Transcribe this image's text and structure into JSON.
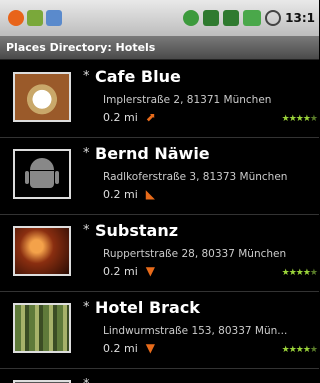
{
  "status_bar": {
    "time": "13:1",
    "icons_left": [
      "notification-icon",
      "android-icon",
      "download-icon"
    ],
    "icons_right": [
      "phone-icon",
      "network-icon",
      "signal-icon",
      "battery-icon",
      "alarm-icon"
    ]
  },
  "title": "Places Directory: Hotels",
  "places": [
    {
      "name": "Cafe Blue",
      "address": "Implerstraße 2, 81371 München",
      "distance": "0.2 mi",
      "direction_icon": "northeast-arrow-icon",
      "direction_glyph": "⬈",
      "rating": 4,
      "rating_max": 5,
      "thumb": "cafe-photo"
    },
    {
      "name": "Bernd Näwie",
      "address": "Radlkoferstraße 3, 81373 München",
      "distance": "0.2 mi",
      "direction_icon": "north-arrow-icon",
      "direction_glyph": "◣",
      "rating": 0,
      "rating_max": 5,
      "thumb": "android-placeholder"
    },
    {
      "name": "Substanz",
      "address": "Ruppertstraße 28, 80337 München",
      "distance": "0.2 mi",
      "direction_icon": "south-arrow-icon",
      "direction_glyph": "▼",
      "rating": 4,
      "rating_max": 5,
      "thumb": "club-photo"
    },
    {
      "name": "Hotel Brack",
      "address": "Lindwurmstraße 153, 80337 Mün...",
      "distance": "0.2 mi",
      "direction_icon": "south-arrow-icon",
      "direction_glyph": "▼",
      "rating": 4,
      "rating_max": 5,
      "thumb": "trees-photo"
    }
  ],
  "colors": {
    "accent_orange": "#e86b1a",
    "rating_green": "#9bd43a",
    "status_bar_bg": "#d0d0d0",
    "title_bar_bg": "#5a5a5a"
  }
}
